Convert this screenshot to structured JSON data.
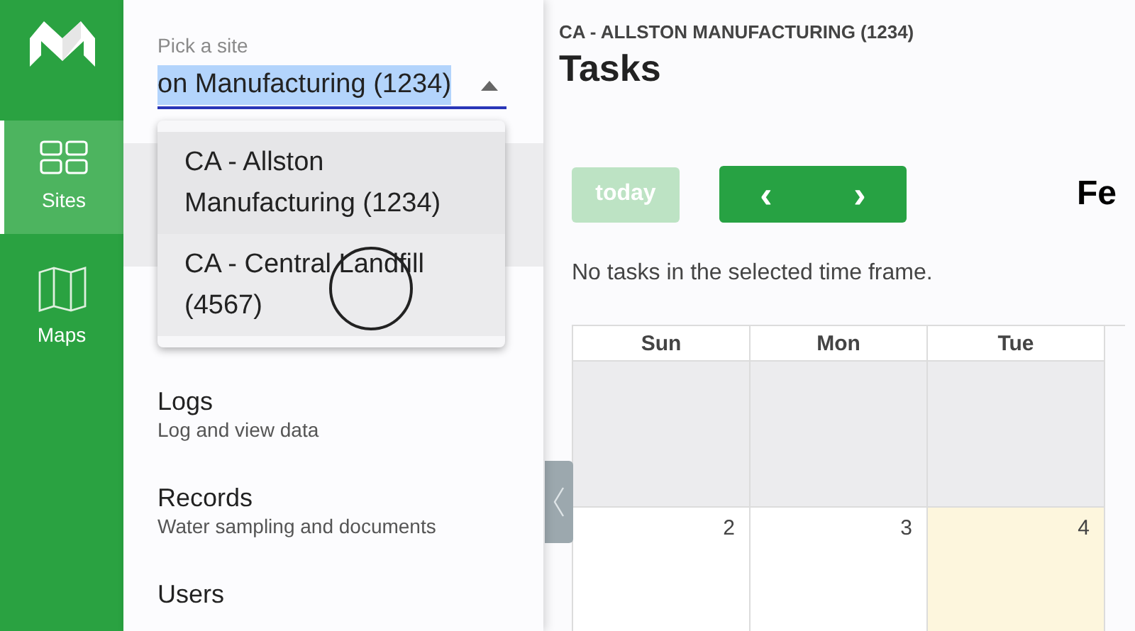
{
  "rail": {
    "items": [
      {
        "label": "Sites",
        "selected": true
      },
      {
        "label": "Maps",
        "selected": false
      }
    ]
  },
  "drawer": {
    "site_picker": {
      "label": "Pick a site",
      "value": "on Manufacturing (1234)",
      "text_selected": true,
      "expanded": true,
      "options": [
        {
          "label": "CA - Allston Manufacturing (1234)",
          "selected": true,
          "hovered": false
        },
        {
          "label": "CA - Central Landfill (4567)",
          "selected": false,
          "hovered": true
        }
      ]
    },
    "items": [
      {
        "title": "Logs",
        "subtitle": "Log and view data"
      },
      {
        "title": "Records",
        "subtitle": "Water sampling and documents"
      },
      {
        "title": "Users"
      }
    ]
  },
  "main": {
    "site": "CA - ALLSTON MANUFACTURING (1234)",
    "title": "Tasks",
    "toolbar": {
      "today": {
        "label": "today",
        "disabled": true
      },
      "prev": "‹",
      "next": "›",
      "month": "Fe"
    },
    "empty_message": "No tasks in the selected time frame.",
    "calendar": {
      "columns": [
        "Sun",
        "Mon",
        "Tue"
      ],
      "weeks": [
        [
          {
            "outside": true,
            "today": false
          },
          {
            "outside": true,
            "today": false
          },
          {
            "outside": true,
            "today": false
          }
        ],
        [
          {
            "day": "2",
            "outside": false,
            "today": false
          },
          {
            "day": "3",
            "outside": false,
            "today": false
          },
          {
            "day": "4",
            "outside": false,
            "today": true
          }
        ]
      ]
    }
  }
}
